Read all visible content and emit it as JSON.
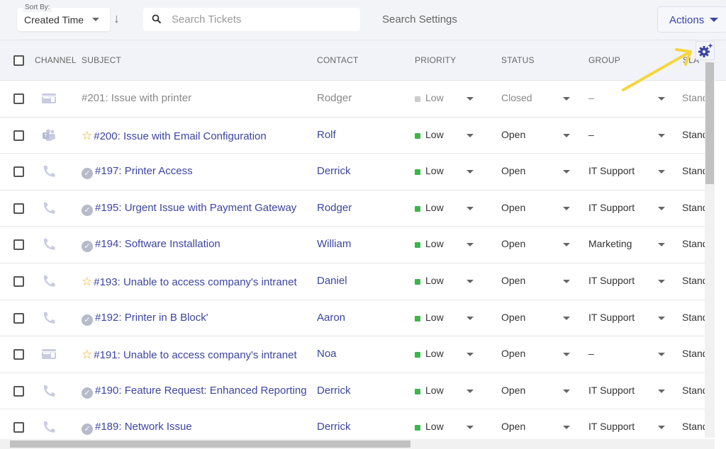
{
  "toolbar": {
    "sort_label": "Sort By:",
    "sort_value": "Created Time",
    "search_placeholder": "Search Tickets",
    "search_settings": "Search Settings",
    "actions": "Actions"
  },
  "columns": {
    "channel": "CHANNEL",
    "subject": "SUBJECT",
    "contact": "CONTACT",
    "priority": "PRIORITY",
    "status": "STATUS",
    "group": "GROUP",
    "sla": "SLA"
  },
  "colors": {
    "accent": "#3d45a0",
    "priority_low": "#3cb54a",
    "star": "#f0a81b",
    "annotation_arrow": "#f5d63d"
  },
  "rows": [
    {
      "channel": "web-icon",
      "mark": "",
      "subject": "#201: Issue with printer",
      "contact": "Rodger",
      "priority": "Low",
      "status": "Closed",
      "group": "–",
      "sla": "Standard",
      "closed": true
    },
    {
      "channel": "teams-icon",
      "mark": "star",
      "subject": "#200: Issue with Email Configuration",
      "contact": "Rolf",
      "priority": "Low",
      "status": "Open",
      "group": "–",
      "sla": "Standard"
    },
    {
      "channel": "phone-icon",
      "mark": "check",
      "subject": "#197: Printer Access",
      "contact": "Derrick",
      "priority": "Low",
      "status": "Open",
      "group": "IT Support",
      "sla": "Standard"
    },
    {
      "channel": "phone-icon",
      "mark": "check",
      "subject": "#195: Urgent Issue with Payment Gateway",
      "contact": "Rodger",
      "priority": "Low",
      "status": "Open",
      "group": "IT Support",
      "sla": "Standard"
    },
    {
      "channel": "phone-icon",
      "mark": "check",
      "subject": "#194: Software Installation",
      "contact": "William",
      "priority": "Low",
      "status": "Open",
      "group": "Marketing",
      "sla": "Standard"
    },
    {
      "channel": "phone-icon",
      "mark": "star",
      "subject": "#193: Unable to access company's intranet",
      "contact": "Daniel",
      "priority": "Low",
      "status": "Open",
      "group": "IT Support",
      "sla": "Standard"
    },
    {
      "channel": "phone-icon",
      "mark": "check",
      "subject": "#192: Printer in B Block'",
      "contact": "Aaron",
      "priority": "Low",
      "status": "Open",
      "group": "IT Support",
      "sla": "Standard"
    },
    {
      "channel": "web-icon",
      "mark": "star",
      "subject": "#191: Unable to access company's intranet",
      "contact": "Noa",
      "priority": "Low",
      "status": "Open",
      "group": "–",
      "sla": "Standard"
    },
    {
      "channel": "phone-icon",
      "mark": "check",
      "subject": "#190: Feature Request: Enhanced Reporting",
      "contact": "Derrick",
      "priority": "Low",
      "status": "Open",
      "group": "IT Support",
      "sla": "Standard"
    },
    {
      "channel": "phone-icon",
      "mark": "check",
      "subject": "#189: Network Issue",
      "contact": "Derrick",
      "priority": "Low",
      "status": "Open",
      "group": "IT Support",
      "sla": "Standard"
    }
  ]
}
